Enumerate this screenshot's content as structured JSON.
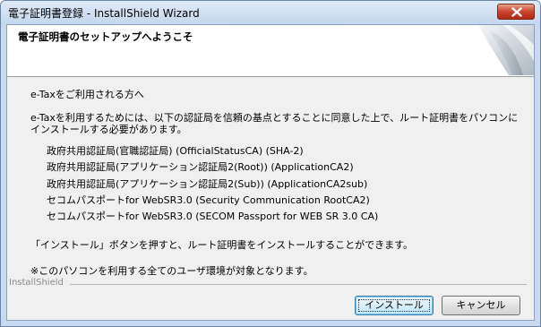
{
  "window": {
    "title": "電子証明書登録 - InstallShield Wizard"
  },
  "banner": {
    "title": "電子証明書のセットアップへようこそ"
  },
  "content": {
    "intro": "e-Taxをご利用される方へ",
    "instruction_line1": "e-Taxを利用するためには、以下の認証局を信頼の基点とすることに同意した上で、ルート証明書をパソコンに",
    "instruction_line2": "インストールする必要があります。",
    "certificate_authorities": [
      "政府共用認証局(官職認証局) (OfficialStatusCA) (SHA-2)",
      "政府共用認証局(アプリケーション認証局2(Root)) (ApplicationCA2)",
      "政府共用認証局(アプリケーション認証局2(Sub)) (ApplicationCA2sub)",
      "セコムパスポートfor WebSR3.0 (Security Communication RootCA2)",
      "セコムパスポートfor WebSR3.0 (SECOM Passport for WEB SR 3.0 CA)"
    ],
    "install_hint": "「インストール」ボタンを押すと、ルート証明書をインストールすることができます。",
    "note": "※このパソコンを利用する全てのユーザ環境が対象となります。"
  },
  "footer": {
    "brand": "InstallShield",
    "install_button": "インストール",
    "cancel_button": "キャンセル"
  },
  "colors": {
    "title_bar": "#c4d6ee",
    "close_button": "#c8442c",
    "dialog_background": "#f0f0f0",
    "default_button_border": "#3c7fb1"
  },
  "icons": {
    "close": "close-icon",
    "banner_art": "wizard-banner-graphic"
  }
}
